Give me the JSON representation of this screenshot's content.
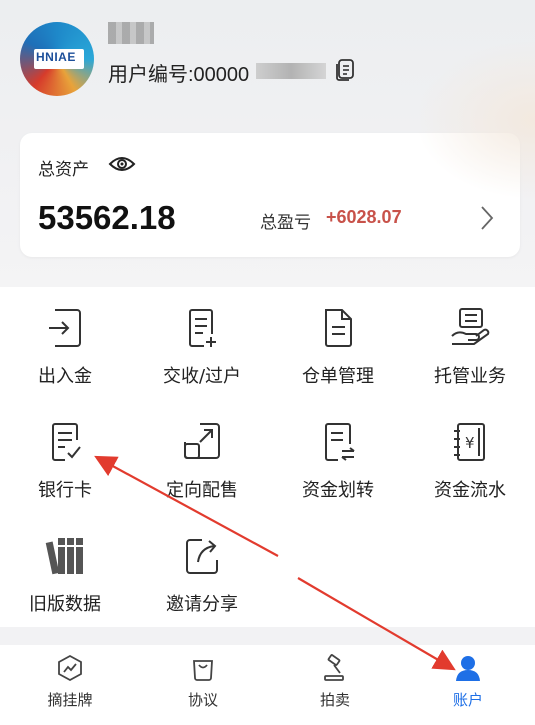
{
  "profile": {
    "logo_text": "HNIAE",
    "user_no_label": "用户编号:00000"
  },
  "assets": {
    "label": "总资产",
    "total_value": "53562.18",
    "pl_label": "总盈亏",
    "pl_value": "+6028.07",
    "pl_color": "#c8524a"
  },
  "menu": [
    {
      "label": "出入金",
      "icon": "deposit-withdraw-icon"
    },
    {
      "label": "交收/过户",
      "icon": "settlement-transfer-icon"
    },
    {
      "label": "仓单管理",
      "icon": "warehouse-receipt-icon"
    },
    {
      "label": "托管业务",
      "icon": "custody-icon"
    },
    {
      "label": "银行卡",
      "icon": "bank-card-icon"
    },
    {
      "label": "定向配售",
      "icon": "directed-placement-icon"
    },
    {
      "label": "资金划转",
      "icon": "fund-transfer-icon"
    },
    {
      "label": "资金流水",
      "icon": "fund-flow-icon"
    },
    {
      "label": "旧版数据",
      "icon": "legacy-data-icon"
    },
    {
      "label": "邀请分享",
      "icon": "share-icon"
    }
  ],
  "tabs": [
    {
      "label": "摘挂牌",
      "icon": "listing-icon",
      "active": false
    },
    {
      "label": "协议",
      "icon": "agreement-icon",
      "active": false
    },
    {
      "label": "拍卖",
      "icon": "auction-icon",
      "active": false
    },
    {
      "label": "账户",
      "icon": "account-icon",
      "active": true
    }
  ],
  "colors": {
    "accent": "#1e6fe6",
    "arrow": "#e23b2e",
    "profit": "#c8524a"
  }
}
